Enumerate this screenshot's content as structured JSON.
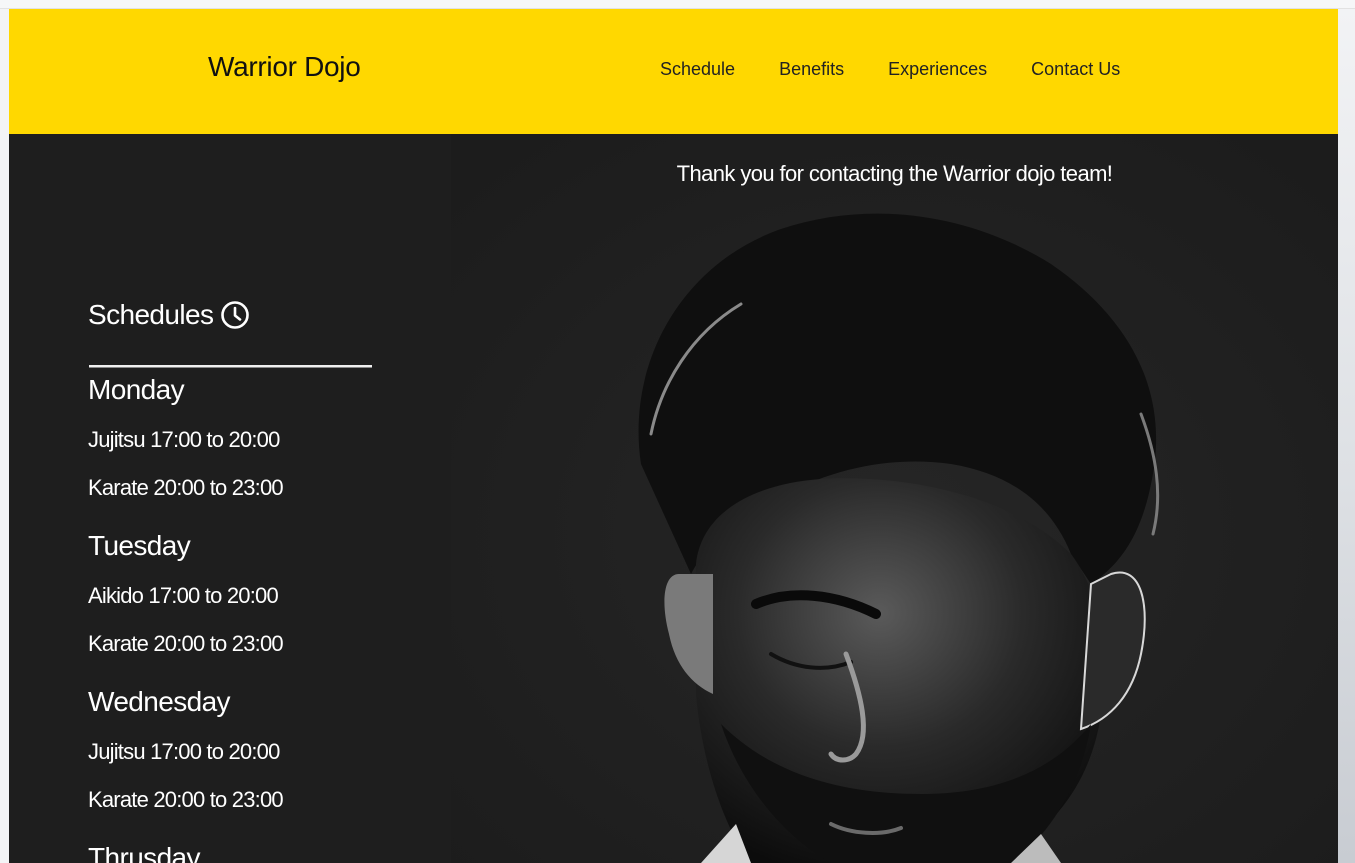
{
  "header": {
    "brand": "Warrior Dojo",
    "nav": [
      {
        "label": "Schedule"
      },
      {
        "label": "Benefits"
      },
      {
        "label": "Experiences"
      },
      {
        "label": "Contact Us"
      }
    ]
  },
  "schedule": {
    "title": "Schedules",
    "icon": "clock-icon",
    "days": [
      {
        "day": "Monday",
        "classes": [
          "Jujitsu 17:00 to 20:00",
          "Karate 20:00 to 23:00"
        ]
      },
      {
        "day": "Tuesday",
        "classes": [
          "Aikido 17:00 to 20:00",
          "Karate 20:00 to 23:00"
        ]
      },
      {
        "day": "Wednesday",
        "classes": [
          "Jujitsu 17:00 to 20:00",
          "Karate 20:00 to 23:00"
        ]
      },
      {
        "day": "Thrusday",
        "classes": []
      }
    ]
  },
  "hero": {
    "message": "Thank you for contacting the Warrior dojo team!"
  },
  "colors": {
    "accent": "#ffd800",
    "background": "#1e1e1e",
    "text_light": "#ffffff",
    "text_dark": "#111111"
  }
}
